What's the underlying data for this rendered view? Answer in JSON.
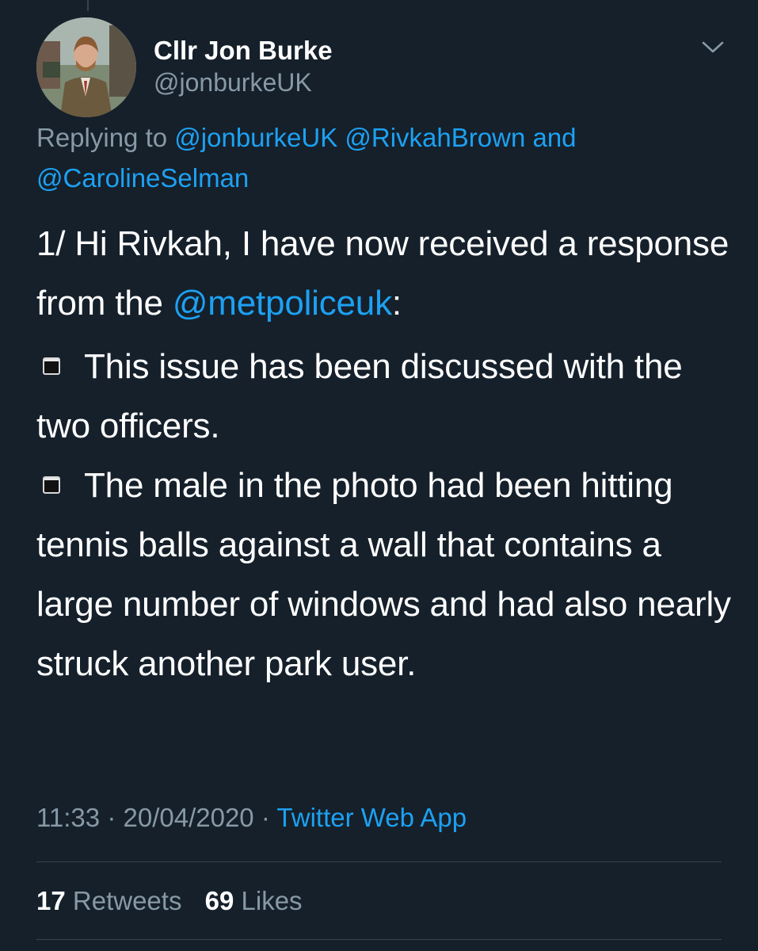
{
  "tweet": {
    "author": {
      "display_name": "Cllr Jon Burke",
      "handle": "@jonburkeUK",
      "avatar_icon": "profile-photo"
    },
    "menu_icon": "chevron-down-icon",
    "replying": {
      "prefix": "Replying to",
      "mentions": [
        "@jonburkeUK",
        "@RivkahBrown",
        "@CarolineSelman"
      ],
      "conjunction": "and"
    },
    "text": {
      "line1_a": "1/ Hi Rivkah, I have now received a response from the ",
      "line1_mention": "@metpoliceuk",
      "line1_b": ":",
      "bullet1": "This issue has been discussed with the two officers.",
      "bullet2": "The male in the photo had been hitting tennis balls against a wall that contains a large number of windows and had also nearly struck another park user."
    },
    "meta": {
      "time": "11:33",
      "separator": "·",
      "date": "20/04/2020",
      "source": "Twitter Web App"
    },
    "stats": {
      "retweets_count": "17",
      "retweets_label": "Retweets",
      "likes_count": "69",
      "likes_label": "Likes"
    }
  },
  "colors": {
    "background": "#15202b",
    "accent": "#1da1f2",
    "secondary_text": "#8899a6",
    "divider": "#38444d"
  }
}
